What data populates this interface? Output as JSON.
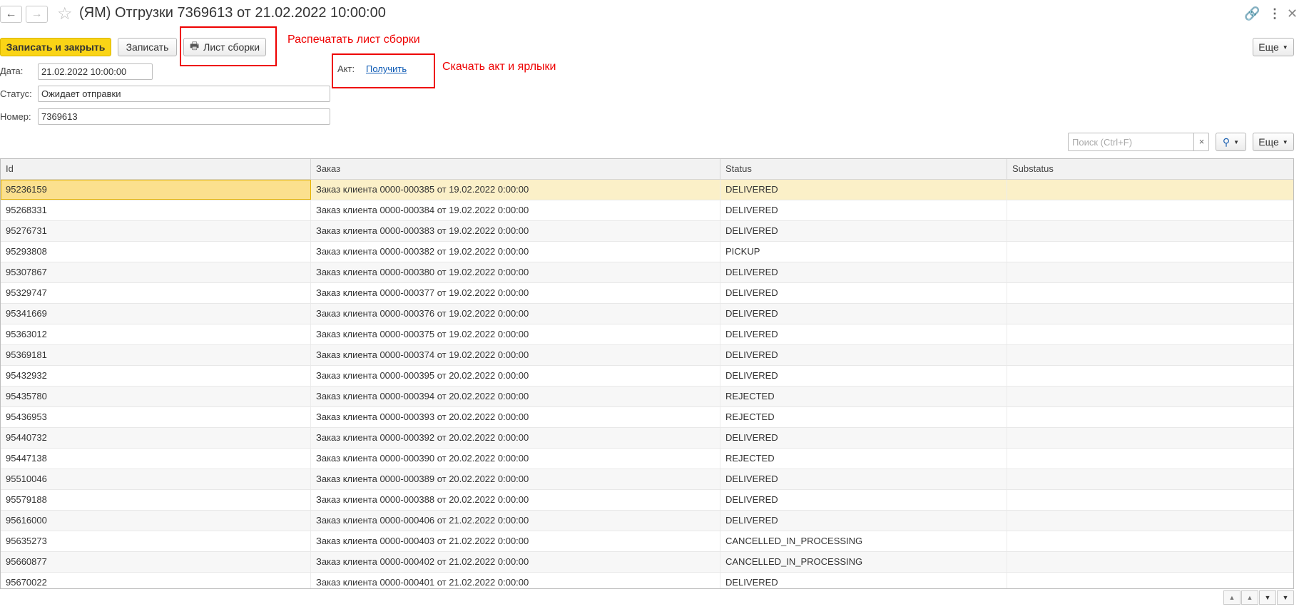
{
  "window": {
    "title": "(ЯМ) Отгрузки 7369613 от 21.02.2022 10:00:00"
  },
  "toolbar": {
    "save_close_label": "Записать и закрыть",
    "save_label": "Записать",
    "assembly_sheet_label": "Лист сборки",
    "more_label": "Еще"
  },
  "annotations": {
    "print_assembly": "Распечатать лист сборки",
    "download_act": "Скачать акт и ярлыки"
  },
  "form": {
    "date_label": "Дата:",
    "date_value": "21.02.2022 10:00:00",
    "status_label": "Статус:",
    "status_value": "Ожидает отправки",
    "number_label": "Номер:",
    "number_value": "7369613",
    "act_label": "Акт:",
    "act_link": "Получить"
  },
  "search": {
    "placeholder": "Поиск (Ctrl+F)",
    "clear": "×"
  },
  "table_toolbar": {
    "more_label": "Еще"
  },
  "table": {
    "columns": [
      "Id",
      "Заказ",
      "Status",
      "Substatus"
    ],
    "rows": [
      [
        "95236159",
        "Заказ клиента 0000-000385 от 19.02.2022 0:00:00",
        "DELIVERED",
        ""
      ],
      [
        "95268331",
        "Заказ клиента 0000-000384 от 19.02.2022 0:00:00",
        "DELIVERED",
        ""
      ],
      [
        "95276731",
        "Заказ клиента 0000-000383 от 19.02.2022 0:00:00",
        "DELIVERED",
        ""
      ],
      [
        "95293808",
        "Заказ клиента 0000-000382 от 19.02.2022 0:00:00",
        "PICKUP",
        ""
      ],
      [
        "95307867",
        "Заказ клиента 0000-000380 от 19.02.2022 0:00:00",
        "DELIVERED",
        ""
      ],
      [
        "95329747",
        "Заказ клиента 0000-000377 от 19.02.2022 0:00:00",
        "DELIVERED",
        ""
      ],
      [
        "95341669",
        "Заказ клиента 0000-000376 от 19.02.2022 0:00:00",
        "DELIVERED",
        ""
      ],
      [
        "95363012",
        "Заказ клиента 0000-000375 от 19.02.2022 0:00:00",
        "DELIVERED",
        ""
      ],
      [
        "95369181",
        "Заказ клиента 0000-000374 от 19.02.2022 0:00:00",
        "DELIVERED",
        ""
      ],
      [
        "95432932",
        "Заказ клиента 0000-000395 от 20.02.2022 0:00:00",
        "DELIVERED",
        ""
      ],
      [
        "95435780",
        "Заказ клиента 0000-000394 от 20.02.2022 0:00:00",
        "REJECTED",
        ""
      ],
      [
        "95436953",
        "Заказ клиента 0000-000393 от 20.02.2022 0:00:00",
        "REJECTED",
        ""
      ],
      [
        "95440732",
        "Заказ клиента 0000-000392 от 20.02.2022 0:00:00",
        "DELIVERED",
        ""
      ],
      [
        "95447138",
        "Заказ клиента 0000-000390 от 20.02.2022 0:00:00",
        "REJECTED",
        ""
      ],
      [
        "95510046",
        "Заказ клиента 0000-000389 от 20.02.2022 0:00:00",
        "DELIVERED",
        ""
      ],
      [
        "95579188",
        "Заказ клиента 0000-000388 от 20.02.2022 0:00:00",
        "DELIVERED",
        ""
      ],
      [
        "95616000",
        "Заказ клиента 0000-000406 от 21.02.2022 0:00:00",
        "DELIVERED",
        ""
      ],
      [
        "95635273",
        "Заказ клиента 0000-000403 от 21.02.2022 0:00:00",
        "CANCELLED_IN_PROCESSING",
        ""
      ],
      [
        "95660877",
        "Заказ клиента 0000-000402 от 21.02.2022 0:00:00",
        "CANCELLED_IN_PROCESSING",
        ""
      ],
      [
        "95670022",
        "Заказ клиента 0000-000401 от 21.02.2022 0:00:00",
        "DELIVERED",
        ""
      ]
    ]
  },
  "colors": {
    "primary_button": "#fad416",
    "annotation_red": "#e00000",
    "selected_row": "#fbf0c8",
    "link": "#0a58b4"
  }
}
